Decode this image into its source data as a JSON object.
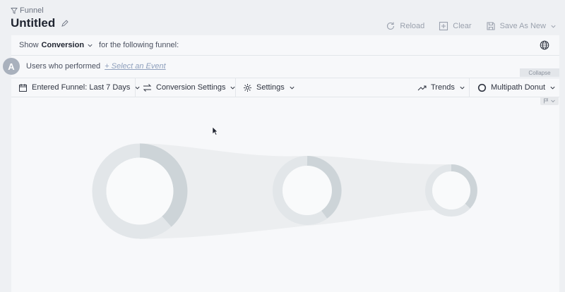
{
  "header": {
    "breadcrumb": "Funnel",
    "title": "Untitled",
    "actions": {
      "reload": "Reload",
      "clear": "Clear",
      "save_as_new": "Save As New"
    }
  },
  "show_row": {
    "show_label": "Show",
    "metric": "Conversion",
    "suffix": "for the following funnel:"
  },
  "step": {
    "avatar_letter": "A",
    "users_label": "Users who performed",
    "select_event": "+ Select an Event",
    "collapse": "Collapse"
  },
  "toolbar": {
    "date_range": "Entered Funnel: Last 7 Days",
    "conversion_settings": "Conversion Settings",
    "settings": "Settings",
    "trends": "Trends",
    "chart_type": "Multipath Donut"
  },
  "colors": {
    "ring_dark": "#cdd4d8",
    "ring_light": "#e2e6e9",
    "flow": "#eceef0"
  },
  "icons": [
    "filter-icon",
    "pencil-icon",
    "reload-icon",
    "add-icon",
    "save-icon",
    "globe-icon",
    "calendar-icon",
    "swap-icon",
    "gear-icon",
    "trend-icon",
    "donut-icon",
    "flag-icon",
    "chevron-down-icon"
  ]
}
